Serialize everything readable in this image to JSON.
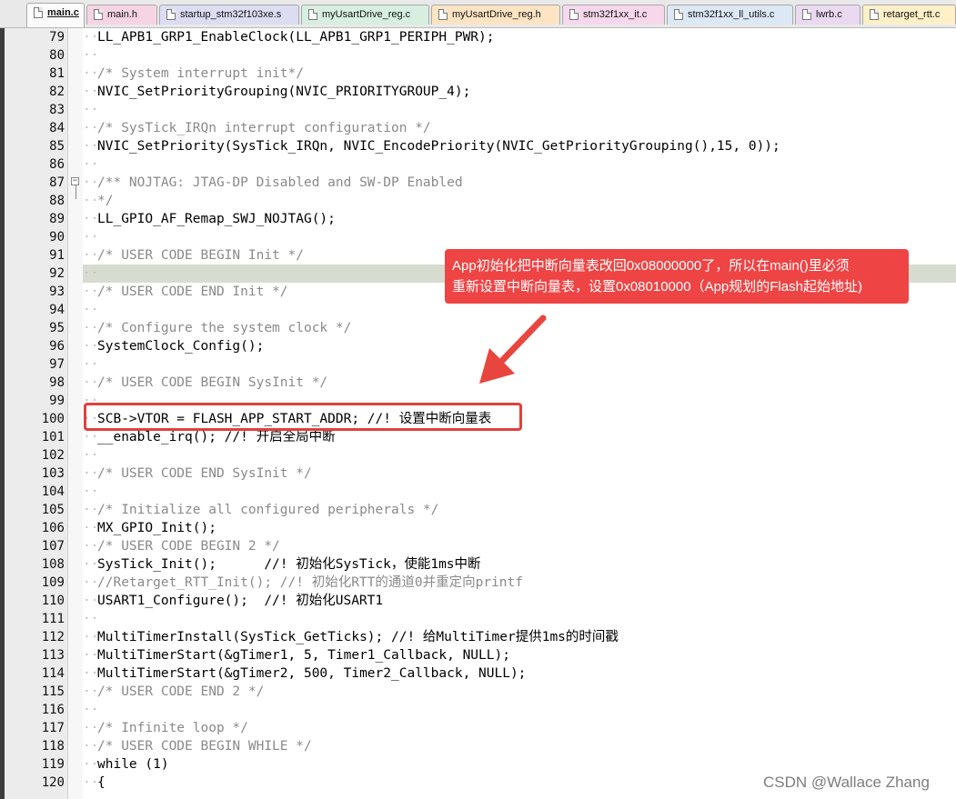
{
  "tabs": [
    {
      "label": "main.c",
      "active": true,
      "color": "#fff2c6"
    },
    {
      "label": "main.h",
      "active": false,
      "color": "#f6d4e4"
    },
    {
      "label": "startup_stm32f103xe.s",
      "active": false,
      "color": "#dcdcf3"
    },
    {
      "label": "myUsartDrive_reg.c",
      "active": false,
      "color": "#d6efe0"
    },
    {
      "label": "myUsartDrive_reg.h",
      "active": false,
      "color": "#ffe4c4"
    },
    {
      "label": "stm32f1xx_it.c",
      "active": false,
      "color": "#f7d7ec"
    },
    {
      "label": "stm32f1xx_ll_utils.c",
      "active": false,
      "color": "#dce8f6"
    },
    {
      "label": "lwrb.c",
      "active": false,
      "color": "#ead9f1"
    },
    {
      "label": "retarget_rtt.c",
      "active": false,
      "color": "#fff0c8"
    }
  ],
  "editor": {
    "highlighted_line": 92,
    "highlight_color": "#d7dcd0",
    "lines": [
      {
        "num": "79",
        "text": "LL_APB1_GRP1_EnableClock(LL_APB1_GRP1_PERIPH_PWR);",
        "comment": false
      },
      {
        "num": "80",
        "text": "",
        "comment": false
      },
      {
        "num": "81",
        "text": "/* System interrupt init*/",
        "comment": true
      },
      {
        "num": "82",
        "text": "NVIC_SetPriorityGrouping(NVIC_PRIORITYGROUP_4);",
        "comment": false
      },
      {
        "num": "83",
        "text": "",
        "comment": false
      },
      {
        "num": "84",
        "text": "/* SysTick_IRQn interrupt configuration */",
        "comment": true
      },
      {
        "num": "85",
        "text": "NVIC_SetPriority(SysTick_IRQn, NVIC_EncodePriority(NVIC_GetPriorityGrouping(),15, 0));",
        "comment": false
      },
      {
        "num": "86",
        "text": "",
        "comment": false
      },
      {
        "num": "87",
        "text": "/** NOJTAG: JTAG-DP Disabled and SW-DP Enabled",
        "comment": true
      },
      {
        "num": "88",
        "text": "*/",
        "comment": true
      },
      {
        "num": "89",
        "text": "LL_GPIO_AF_Remap_SWJ_NOJTAG();",
        "comment": false
      },
      {
        "num": "90",
        "text": "",
        "comment": false
      },
      {
        "num": "91",
        "text": "/* USER CODE BEGIN Init */",
        "comment": true
      },
      {
        "num": "92",
        "text": "",
        "comment": false
      },
      {
        "num": "93",
        "text": "/* USER CODE END Init */",
        "comment": true
      },
      {
        "num": "94",
        "text": "",
        "comment": false
      },
      {
        "num": "95",
        "text": "/* Configure the system clock */",
        "comment": true
      },
      {
        "num": "96",
        "text": "SystemClock_Config();",
        "comment": false
      },
      {
        "num": "97",
        "text": "",
        "comment": false
      },
      {
        "num": "98",
        "text": "/* USER CODE BEGIN SysInit */",
        "comment": true
      },
      {
        "num": "99",
        "text": "",
        "comment": false
      },
      {
        "num": "100",
        "text": "SCB->VTOR = FLASH_APP_START_ADDR; //! 设置中断向量表",
        "comment": false
      },
      {
        "num": "101",
        "text": "__enable_irq(); //! 开启全局中断",
        "comment": false
      },
      {
        "num": "102",
        "text": "",
        "comment": false
      },
      {
        "num": "103",
        "text": "/* USER CODE END SysInit */",
        "comment": true
      },
      {
        "num": "104",
        "text": "",
        "comment": false
      },
      {
        "num": "105",
        "text": "/* Initialize all configured peripherals */",
        "comment": true
      },
      {
        "num": "106",
        "text": "MX_GPIO_Init();",
        "comment": false
      },
      {
        "num": "107",
        "text": "/* USER CODE BEGIN 2 */",
        "comment": true
      },
      {
        "num": "108",
        "text": "SysTick_Init();      //! 初始化SysTick，使能1ms中断",
        "comment": false
      },
      {
        "num": "109",
        "text": "//Retarget_RTT_Init(); //! 初始化RTT的通道0并重定向printf",
        "comment": true
      },
      {
        "num": "110",
        "text": "USART1_Configure();  //! 初始化USART1",
        "comment": false
      },
      {
        "num": "111",
        "text": "",
        "comment": false
      },
      {
        "num": "112",
        "text": "MultiTimerInstall(SysTick_GetTicks); //! 给MultiTimer提供1ms的时间戳",
        "comment": false
      },
      {
        "num": "113",
        "text": "MultiTimerStart(&gTimer1, 5, Timer1_Callback, NULL);",
        "comment": false
      },
      {
        "num": "114",
        "text": "MultiTimerStart(&gTimer2, 500, Timer2_Callback, NULL);",
        "comment": false
      },
      {
        "num": "115",
        "text": "/* USER CODE END 2 */",
        "comment": true
      },
      {
        "num": "116",
        "text": "",
        "comment": false
      },
      {
        "num": "117",
        "text": "/* Infinite loop */",
        "comment": true
      },
      {
        "num": "118",
        "text": "/* USER CODE BEGIN WHILE */",
        "comment": true
      },
      {
        "num": "119",
        "text": "while (1)",
        "comment": false
      },
      {
        "num": "120",
        "text": "{",
        "comment": false
      }
    ]
  },
  "annotation": {
    "line1": "App初始化把中断向量表改回0x08000000了，所以在main()里必须",
    "line2": "重新设置中断向量表，设置0x08010000（App规划的Flash起始地址)",
    "callout_color": "#ef4444",
    "box_color": "#e0403d"
  },
  "watermark": "CSDN @Wallace Zhang"
}
